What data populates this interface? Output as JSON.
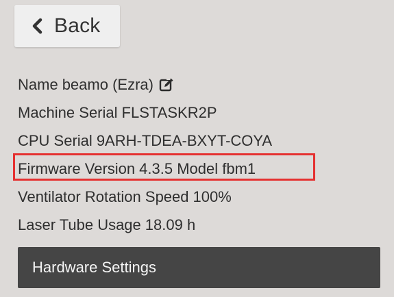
{
  "back_button": {
    "label": "Back",
    "icon": "chevron-left-icon"
  },
  "info": {
    "name": {
      "label": "Name",
      "value": "beamo (Ezra)",
      "icon": "edit-icon"
    },
    "machine_serial": {
      "label": "Machine Serial",
      "value": "FLSTASKR2P"
    },
    "cpu_serial": {
      "label": "CPU Serial",
      "value": "9ARH-TDEA-BXYT-COYA"
    },
    "firmware_version": {
      "label": "Firmware Version",
      "value": "4.3.5 Model fbm1"
    },
    "ventilator_speed": {
      "label": "Ventilator Rotation Speed",
      "value": "100%"
    },
    "laser_tube_usage": {
      "label": "Laser Tube Usage",
      "value": "18.09 h"
    }
  },
  "hardware_settings": {
    "label": "Hardware Settings"
  },
  "colors": {
    "background": "#dddad8",
    "highlight": "#e53030",
    "hardware_button_bg": "#454545"
  }
}
